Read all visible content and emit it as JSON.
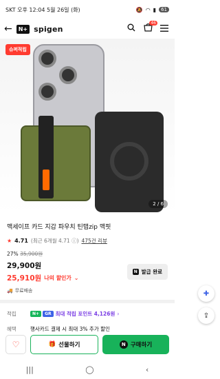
{
  "status": {
    "carrier": "SKT 오후 12:04 5월 26일 (화)",
    "battery": "61"
  },
  "header": {
    "nplus": "N+",
    "brand": "spigen",
    "cart_count": "46"
  },
  "hero": {
    "badge": "슈퍼적립",
    "counter": "2 / 6"
  },
  "product": {
    "title": "맥세이프 카드 지갑 파우치 틴탭zip 맥핏",
    "rating": "4.71",
    "rating_note": "(최근 6개월 4.71 ⓘ)",
    "reviews": "475건 리뷰",
    "discount_pct": "27%",
    "orig_price": "35,900원",
    "price": "29,900원",
    "my_price": "25,910원",
    "my_price_label": "나의 할인가",
    "coupon": "발급 완료",
    "shipping": "무료배송"
  },
  "rows": {
    "points_key": "적립",
    "points_text": "최대 적립 포인트 4,126원",
    "benefit_key": "혜택",
    "benefit_text": "행사카드 결제 시 최대 3% 추가 할인"
  },
  "bottom": {
    "gift_label": "선물하기",
    "buy_label": "구매하기"
  }
}
